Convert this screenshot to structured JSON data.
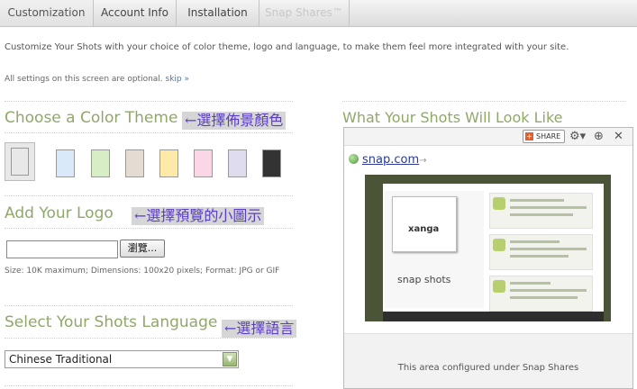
{
  "tabs": [
    {
      "label": "Customization",
      "state": "active"
    },
    {
      "label": "Account Info",
      "state": "normal"
    },
    {
      "label": "Installation",
      "state": "normal"
    },
    {
      "label": "Snap Shares™",
      "state": "disabled"
    }
  ],
  "intro": "Customize Your Shots with your choice of color theme, logo and language, to make them feel more integrated with your site.",
  "optional_note": "All settings on this screen are optional.",
  "skip_link": "skip »",
  "color_theme": {
    "heading": "Choose a Color Theme",
    "annotation": "←選擇佈景顏色",
    "swatches": [
      "#e8e8e8",
      "#d9e8fb",
      "#d7eec4",
      "#e4dcd3",
      "#fde9a8",
      "#fbd6e6",
      "#e0dcf0",
      "#333333"
    ],
    "selected_index": 0
  },
  "logo": {
    "heading": "Add Your Logo",
    "annotation": "←選擇預覽的小圖示",
    "file_value": "",
    "browse_label": "瀏覽...",
    "size_note": "Size: 10K maximum; Dimensions: 100x20 pixels; Format: JPG or GIF"
  },
  "language": {
    "heading": "Select Your Shots Language",
    "annotation": "←選擇語言",
    "selected": "Chinese Traditional"
  },
  "preview": {
    "heading": "What Your Shots Will Look Like",
    "share_label": "SHARE",
    "link_text": "snap.com",
    "thumb_xanga": "xanga",
    "thumb_logo": "snap shots",
    "note": "This area configured under Snap Shares"
  },
  "colors": {
    "accent_green": "#8fa86a",
    "annotation_purple": "#5a3cc8",
    "link_blue": "#4a76b4"
  },
  "icons": {
    "gear": "gear-icon",
    "zoom": "zoom-icon",
    "close": "close-icon",
    "dropdown": "chevron-down-icon"
  }
}
